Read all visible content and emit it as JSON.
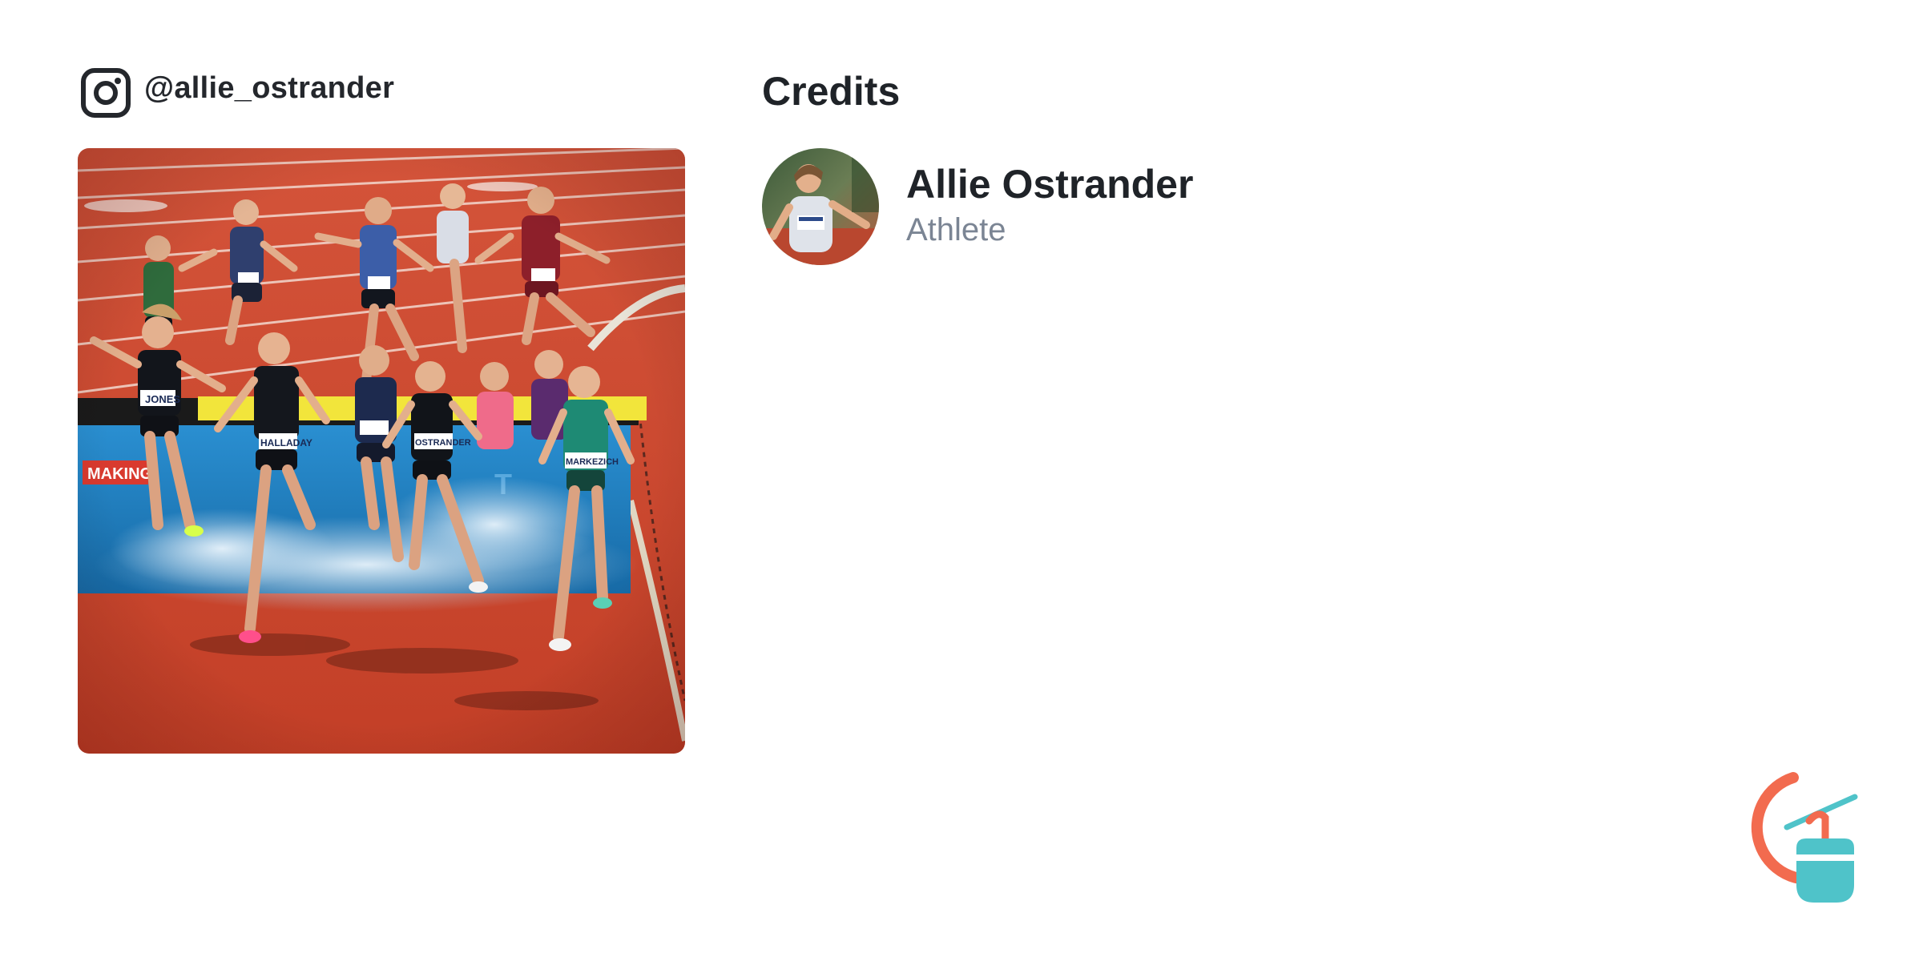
{
  "post": {
    "platform_icon": "instagram-icon",
    "handle": "@allie_ostrander",
    "photo_description_icon": "steeplechase-race-photo"
  },
  "credits": {
    "title": "Credits",
    "people": [
      {
        "name": "Allie Ostrander",
        "role": "Athlete",
        "avatar_icon": "athlete-avatar"
      }
    ]
  },
  "brand": {
    "logo_icon": "gondola-logo-icon",
    "colors": {
      "orange": "#f26b4f",
      "teal": "#4fc3c9"
    }
  },
  "colors": {
    "text_primary": "#1f2328",
    "text_secondary": "#7b8594",
    "track_red": "#c9442c",
    "water_blue": "#1e7fc2"
  }
}
